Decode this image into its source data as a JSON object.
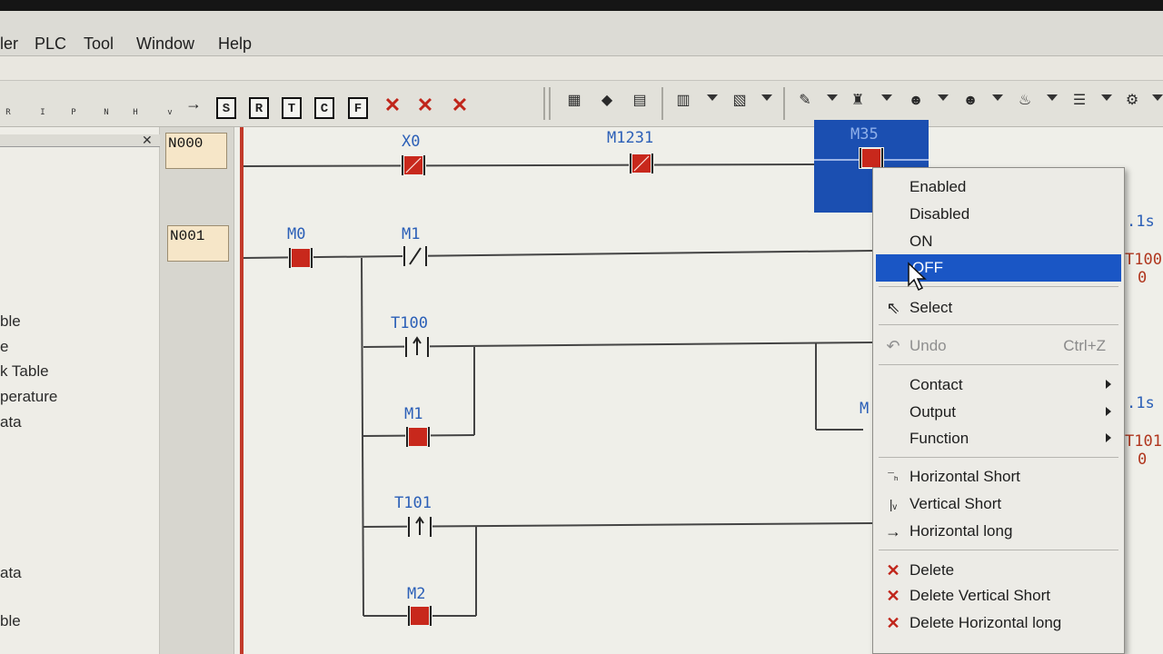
{
  "menubar": {
    "partial_item": "ler",
    "items": [
      "PLC",
      "Tool",
      "Window",
      "Help"
    ]
  },
  "toolbar": {
    "ladder_keys": [
      "R",
      "I",
      "P",
      "N",
      "H",
      "v"
    ],
    "box_buttons": [
      "S",
      "R",
      "T",
      "C",
      "F"
    ],
    "icons": [
      "normal-open-icon",
      "normal-close-icon",
      "rising-edge-icon",
      "falling-edge-icon",
      "horizontal-line-icon",
      "vertical-line-icon",
      "arrow-line-icon",
      "delete-icon",
      "delete-vertical-icon",
      "delete-horizontal-icon",
      "network-icon",
      "transfer-icon",
      "monitor-icon",
      "io-icon",
      "step-icon",
      "ladder-edit-icon",
      "plc-status-icon",
      "user-icon",
      "user-alt-icon",
      "lamp-icon",
      "list-icon",
      "settings-icon"
    ]
  },
  "left_panel": {
    "items_partial": [
      "ble",
      "e",
      "k Table",
      "perature",
      "ata",
      "ata",
      "ble"
    ]
  },
  "rungs": [
    "N000",
    "N001"
  ],
  "ladder": {
    "contacts": [
      {
        "label": "X0",
        "state": "on"
      },
      {
        "label": "M1231",
        "state": "on"
      },
      {
        "label": "M35",
        "state": "on",
        "selected": true
      },
      {
        "label": "M0",
        "state": "on"
      },
      {
        "label": "M1",
        "state": "nc"
      },
      {
        "label": "T100",
        "state": "rising"
      },
      {
        "label": "M1",
        "state": "on"
      },
      {
        "label": "T101",
        "state": "rising"
      },
      {
        "label": "M2",
        "state": "on"
      }
    ],
    "right_labels": [
      ".1s",
      "T100",
      "0",
      "M",
      ".1s",
      "T101",
      "0"
    ]
  },
  "context_menu": {
    "items": [
      {
        "label": "Enabled",
        "type": "plain"
      },
      {
        "label": "Disabled",
        "type": "plain"
      },
      {
        "label": "ON",
        "type": "plain"
      },
      {
        "label": "OFF",
        "type": "highlighted"
      },
      {
        "label": "Select",
        "type": "icon",
        "icon": "cursor-icon"
      },
      {
        "label": "Undo",
        "type": "disabled",
        "shortcut": "Ctrl+Z",
        "icon": "undo-icon"
      },
      {
        "label": "Contact",
        "type": "submenu"
      },
      {
        "label": "Output",
        "type": "submenu"
      },
      {
        "label": "Function",
        "type": "submenu"
      },
      {
        "label": "Horizontal Short",
        "type": "icon",
        "icon": "horizontal-short-icon"
      },
      {
        "label": "Vertical Short",
        "type": "icon",
        "icon": "vertical-short-icon"
      },
      {
        "label": "Horizontal long",
        "type": "icon",
        "icon": "horizontal-long-icon"
      },
      {
        "label": "Delete",
        "type": "icon",
        "icon": "delete-icon"
      },
      {
        "label": "Delete Vertical Short",
        "type": "icon",
        "icon": "delete-vertical-short-icon"
      },
      {
        "label": "Delete Horizontal long",
        "type": "icon",
        "icon": "delete-horizontal-long-icon"
      }
    ]
  },
  "colors": {
    "contact_fill": "#c8281c",
    "ladder_label": "#1e4fb3",
    "menu_highlight": "#1a56c5",
    "rail": "#c23a2a"
  }
}
